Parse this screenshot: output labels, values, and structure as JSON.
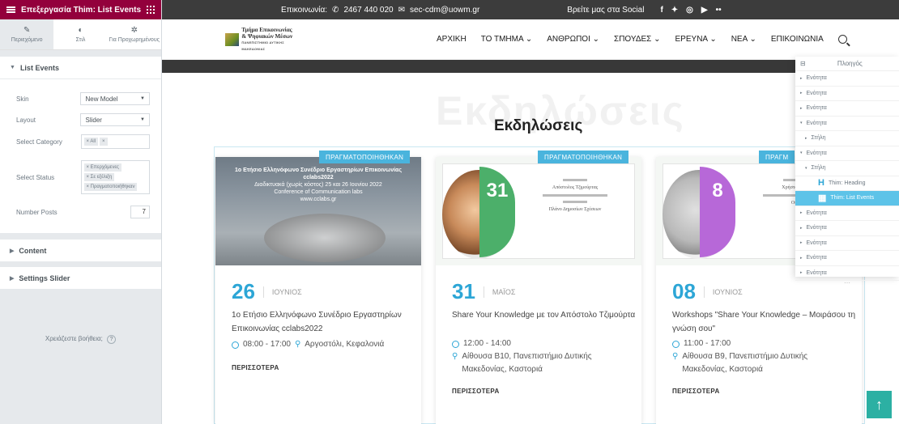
{
  "editor": {
    "header_title": "Επεξεργασία Thim: List Events",
    "tabs": [
      {
        "label": "Περιεχόμενο",
        "icon": "pencil-icon"
      },
      {
        "label": "Στιλ",
        "icon": "half-circle-icon"
      },
      {
        "label": "Για Προχωρημένους",
        "icon": "gear-icon"
      }
    ],
    "section_list_events": "List Events",
    "controls": {
      "skin_label": "Skin",
      "skin_value": "New Model",
      "layout_label": "Layout",
      "layout_value": "Slider",
      "category_label": "Select Category",
      "category_tag": "× All",
      "status_label": "Select Status",
      "status_tags": [
        "× Επερχόμενες",
        "× Σε εξέλιξη",
        "× Πραγματοποιήθηκαν"
      ],
      "posts_label": "Number Posts",
      "posts_value": "7"
    },
    "section_content": "Content",
    "section_settings": "Settings Slider",
    "help_text": "Χρειάζεστε βοήθεια;"
  },
  "site": {
    "topbar": {
      "contact_label": "Επικοινωνία:",
      "phone": "2467 440 020",
      "email": "sec-cdm@uowm.gr",
      "social_label": "Βρείτε μας στα Social"
    },
    "logo": {
      "line1": "Τμήμα Επικοινωνίας",
      "line2": "& Ψηφιακών Μέσων",
      "line3": "ΠΑΝΕΠΙΣΤΗΜΙΟ ΔΥΤΙΚΗΣ ΜΑΚΕΔΟΝΙΑΣ"
    },
    "menu": [
      "ΑΡΧΙΚΗ",
      "ΤΟ ΤΜΗΜΑ ⌄",
      "ΑΝΘΡΩΠΟΙ ⌄",
      "ΣΠΟΥΔΕΣ ⌄",
      "ΕΡΕΥΝΑ ⌄",
      "ΝΕΑ ⌄",
      "ΕΠΙΚΟΙΝΩΝΙΑ"
    ],
    "watermark": "Εκδηλώσεις",
    "page_title": "Εκδηλώσεις",
    "ribbon_text": "ΠΡΑΓΜΑΤΟΠΟΙΗΘΗΚΑΝ",
    "ribbon_partial": "ΠΡΑΓΜ",
    "more_label": "ΠΕΡΙΣΣΟΤΕΡΑ",
    "events": [
      {
        "day": "26",
        "month": "ΙΟΥΝΙΟΣ",
        "title": "1ο Ετήσιο Ελληνόφωνο Συνέδριο Εργαστηρίων Επικοινωνίας cclabs2022",
        "time": "08:00 - 17:00",
        "location": "Αργοστόλι, Κεφαλονιά",
        "image_lines": [
          "1ο Ετήσιο Ελληνόφωνο Συνέδριο Εργαστηρίων Επικοινωνίας",
          "cclabs2022",
          "Διαδικτυακά (χωρίς κόστος) 25 και 26 Ιουνίου 2022",
          "Conference of Communication labs",
          "www.cclabs.gr"
        ]
      },
      {
        "day": "31",
        "month": "ΜΑΪΟΣ",
        "title": "Share Your Knowledge με τον Απόστολο Τζιμούρτα",
        "time": "12:00 - 14:00",
        "location": "Αίθουσα Β10, Πανεπιστήμιο Δυτικής Μακεδονίας, Καστοριά",
        "poster_day": "31",
        "poster_name": "Απόστολος Τζιμούρτας",
        "poster_sub": "Πλάνο Δημοσίων Σχέσεων"
      },
      {
        "day": "08",
        "month": "ΙΟΥΝΙΟΣ",
        "title": "Workshops \"Share Your Knowledge – Μοιράσου τη γνώση σου\"",
        "time": "11:00 - 17:00",
        "location": "Αίθουσα Β9, Πανεπιστήμιο Δυτικής Μακεδονίας, Καστοριά",
        "poster_day": "8",
        "poster_name": "Χρήστος Φρα",
        "poster_sub": "Οι δ"
      }
    ],
    "navigator": {
      "title": "Πλοηγός",
      "rows": [
        {
          "label": "Ενότητα",
          "level": 0,
          "arrow": "▸"
        },
        {
          "label": "Ενότητα",
          "level": 0,
          "arrow": "▸"
        },
        {
          "label": "Ενότητα",
          "level": 0,
          "arrow": "▸"
        },
        {
          "label": "Ενότητα",
          "level": 0,
          "arrow": "▾"
        },
        {
          "label": "Στήλη",
          "level": 1,
          "arrow": "▸"
        },
        {
          "label": "Ενότητα",
          "level": 0,
          "arrow": "▾"
        },
        {
          "label": "Στήλη",
          "level": 1,
          "arrow": "▾"
        },
        {
          "label": "Thim: Heading",
          "level": 2,
          "arrow": "",
          "icon": "H"
        },
        {
          "label": "Thim: List Events",
          "level": 2,
          "arrow": "",
          "icon": "▦",
          "active": true
        },
        {
          "label": "Ενότητα",
          "level": 0,
          "arrow": "▸"
        },
        {
          "label": "Ενότητα",
          "level": 0,
          "arrow": "▸"
        },
        {
          "label": "Ενότητα",
          "level": 0,
          "arrow": "▸"
        },
        {
          "label": "Ενότητα",
          "level": 0,
          "arrow": "▸"
        },
        {
          "label": "Ενότητα",
          "level": 0,
          "arrow": "▸"
        }
      ]
    }
  }
}
